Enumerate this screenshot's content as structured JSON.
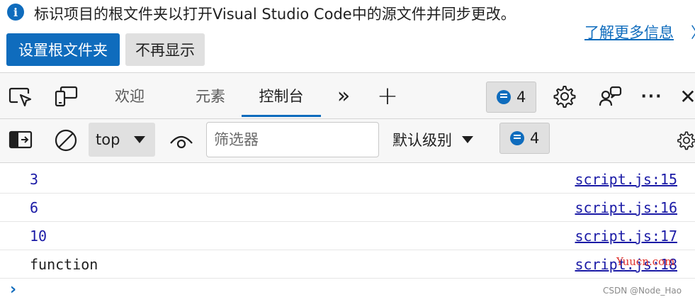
{
  "banner": {
    "message": "标识项目的根文件夹以打开Visual Studio Code中的源文件并同步更改。",
    "learn_more": "了解更多信息",
    "learn_more_chevron": "〉",
    "set_root_button": "设置根文件夹",
    "dont_show_button": "不再显示",
    "info_icon_glyph": "i"
  },
  "toolbar": {
    "tabs": [
      {
        "label": "欢迎"
      },
      {
        "label": "元素"
      },
      {
        "label": "控制台",
        "active": true
      }
    ],
    "more_tabs_glyph": "»",
    "add_tab_glyph": "+",
    "issues_count": "4",
    "more_glyph": "···",
    "close_glyph": "✕"
  },
  "filterbar": {
    "context": "top",
    "filter_placeholder": "筛选器",
    "levels_label": "默认级别",
    "issues_count": "4"
  },
  "console": {
    "messages": [
      {
        "text": "3",
        "source": "script.js:15",
        "kind": "number"
      },
      {
        "text": "6",
        "source": "script.js:16",
        "kind": "number"
      },
      {
        "text": "10",
        "source": "script.js:17",
        "kind": "number"
      },
      {
        "text": "function",
        "source": "script.js:18",
        "kind": "string"
      }
    ],
    "prompt_glyph": "›"
  },
  "watermarks": {
    "site": "Yuucn.com",
    "author": "CSDN @Node_Hao"
  },
  "colors": {
    "accent": "#0f6cbd",
    "console_number": "#1a1aa6",
    "watermark_red": "#e0322c"
  }
}
